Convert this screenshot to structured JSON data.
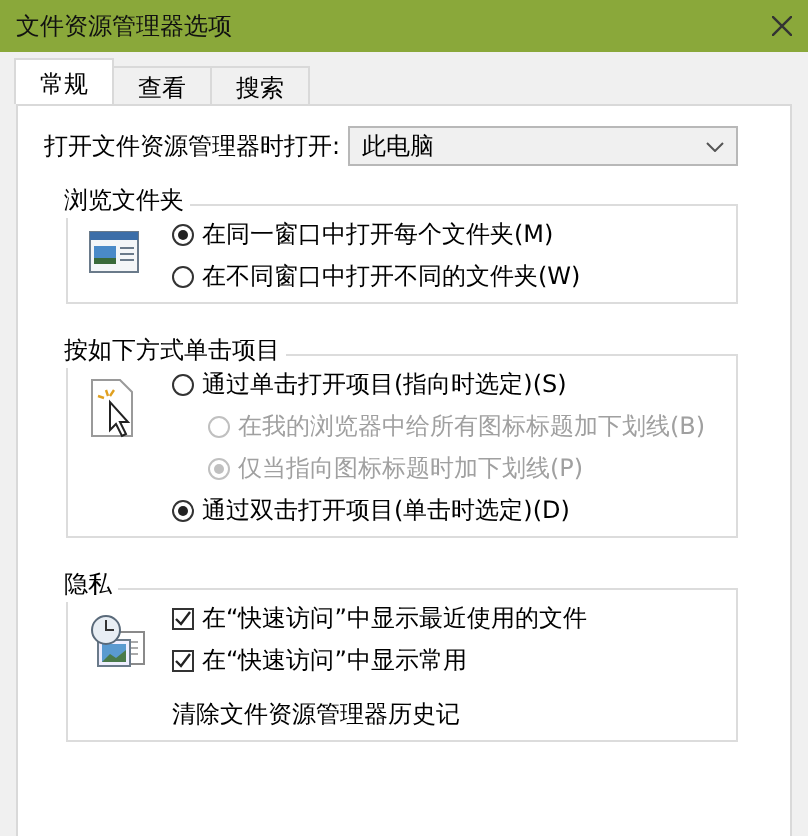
{
  "window": {
    "title": "文件资源管理器选项"
  },
  "tabs": [
    {
      "label": "常规",
      "selected": true
    },
    {
      "label": "查看",
      "selected": false
    },
    {
      "label": "搜索",
      "selected": false
    }
  ],
  "open_in": {
    "label": "打开文件资源管理器时打开:",
    "value": "此电脑"
  },
  "groups": [
    {
      "title": "浏览文件夹",
      "items": [
        {
          "kind": "radio",
          "label": "在同一窗口中打开每个文件夹(M)",
          "selected": true,
          "disabled": false
        },
        {
          "kind": "radio",
          "label": "在不同窗口中打开不同的文件夹(W)",
          "selected": false,
          "disabled": false
        }
      ]
    },
    {
      "title": "按如下方式单击项目",
      "items": [
        {
          "kind": "radio",
          "label": "通过单击打开项目(指向时选定)(S)",
          "selected": false,
          "disabled": false,
          "children": [
            {
              "kind": "radio",
              "label": "在我的浏览器中给所有图标标题加下划线(B)",
              "selected": false,
              "disabled": true
            },
            {
              "kind": "radio",
              "label": "仅当指向图标标题时加下划线(P)",
              "selected": true,
              "disabled": true
            }
          ]
        },
        {
          "kind": "radio",
          "label": "通过双击打开项目(单击时选定)(D)",
          "selected": true,
          "disabled": false
        }
      ]
    },
    {
      "title": "隐私",
      "items": [
        {
          "kind": "checkbox",
          "label": "在“快速访问”中显示最近使用的文件",
          "checked": true
        },
        {
          "kind": "checkbox",
          "label": "在“快速访问”中显示常用",
          "checked": true
        },
        {
          "kind": "text",
          "label": "清除文件资源管理器历史记"
        }
      ]
    }
  ]
}
